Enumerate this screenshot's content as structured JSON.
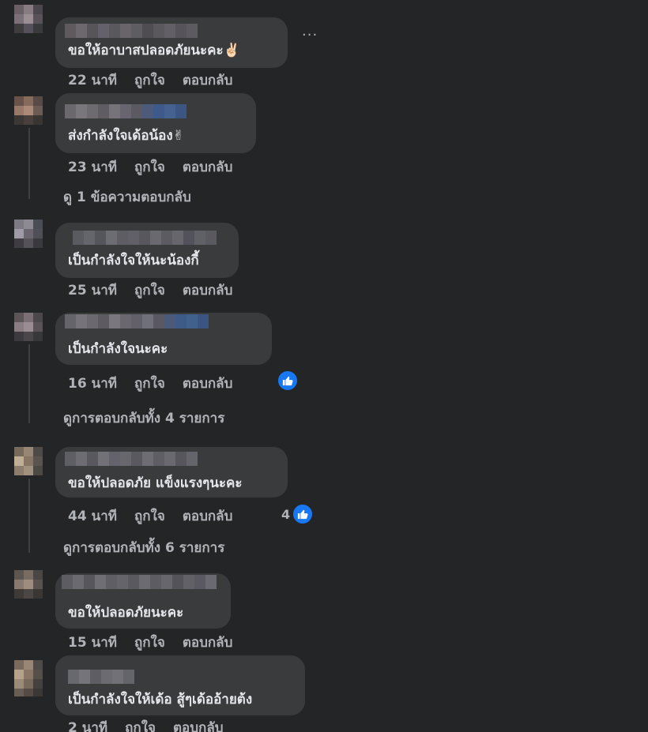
{
  "more_options_label": "···",
  "comments": [
    {
      "text": "ขอให้อาบาสปลอดภัยนะคะ✌🏻",
      "time": "22 นาที",
      "like": "ถูกใจ",
      "reply": "ตอบกลับ"
    },
    {
      "text": "ส่งกำลังใจเด้อน้อง✌",
      "time": "23 นาที",
      "like": "ถูกใจ",
      "reply": "ตอบกลับ",
      "view_replies": "ดู 1 ข้อความตอบกลับ"
    },
    {
      "text": "เป็นกำลังใจให้นะน้องกี้",
      "time": "25 นาที",
      "like": "ถูกใจ",
      "reply": "ตอบกลับ"
    },
    {
      "text": "เป็นกำลังใจนะคะ",
      "time": "16 นาที",
      "like": "ถูกใจ",
      "reply": "ตอบกลับ",
      "view_replies": "ดูการตอบกลับทั้ง 4 รายการ"
    },
    {
      "text": "ขอให้ปลอดภัย แข็งแรงๆนะคะ",
      "time": "44 นาที",
      "like": "ถูกใจ",
      "reply": "ตอบกลับ",
      "reaction_count": "4",
      "view_replies": "ดูการตอบกลับทั้ง 6 รายการ"
    },
    {
      "text": "ขอให้ปลอดภัยนะคะ",
      "time": "15 นาที",
      "like": "ถูกใจ",
      "reply": "ตอบกลับ"
    },
    {
      "text": "เป็นกำลังใจให้เด้อ สู้ๆเด้ออ้ายต้ง",
      "time": "2 นาที",
      "like": "ถูกใจ",
      "reply": "ตอบกลับ"
    }
  ],
  "colors": {
    "background": "#242526",
    "bubble": "#3a3b3c",
    "text": "#e4e6eb",
    "meta": "#b0b3b8",
    "like_blue": "#1877f2"
  },
  "icons": {
    "like_reaction": "thumbs-up-icon",
    "more": "more-dots-icon"
  }
}
